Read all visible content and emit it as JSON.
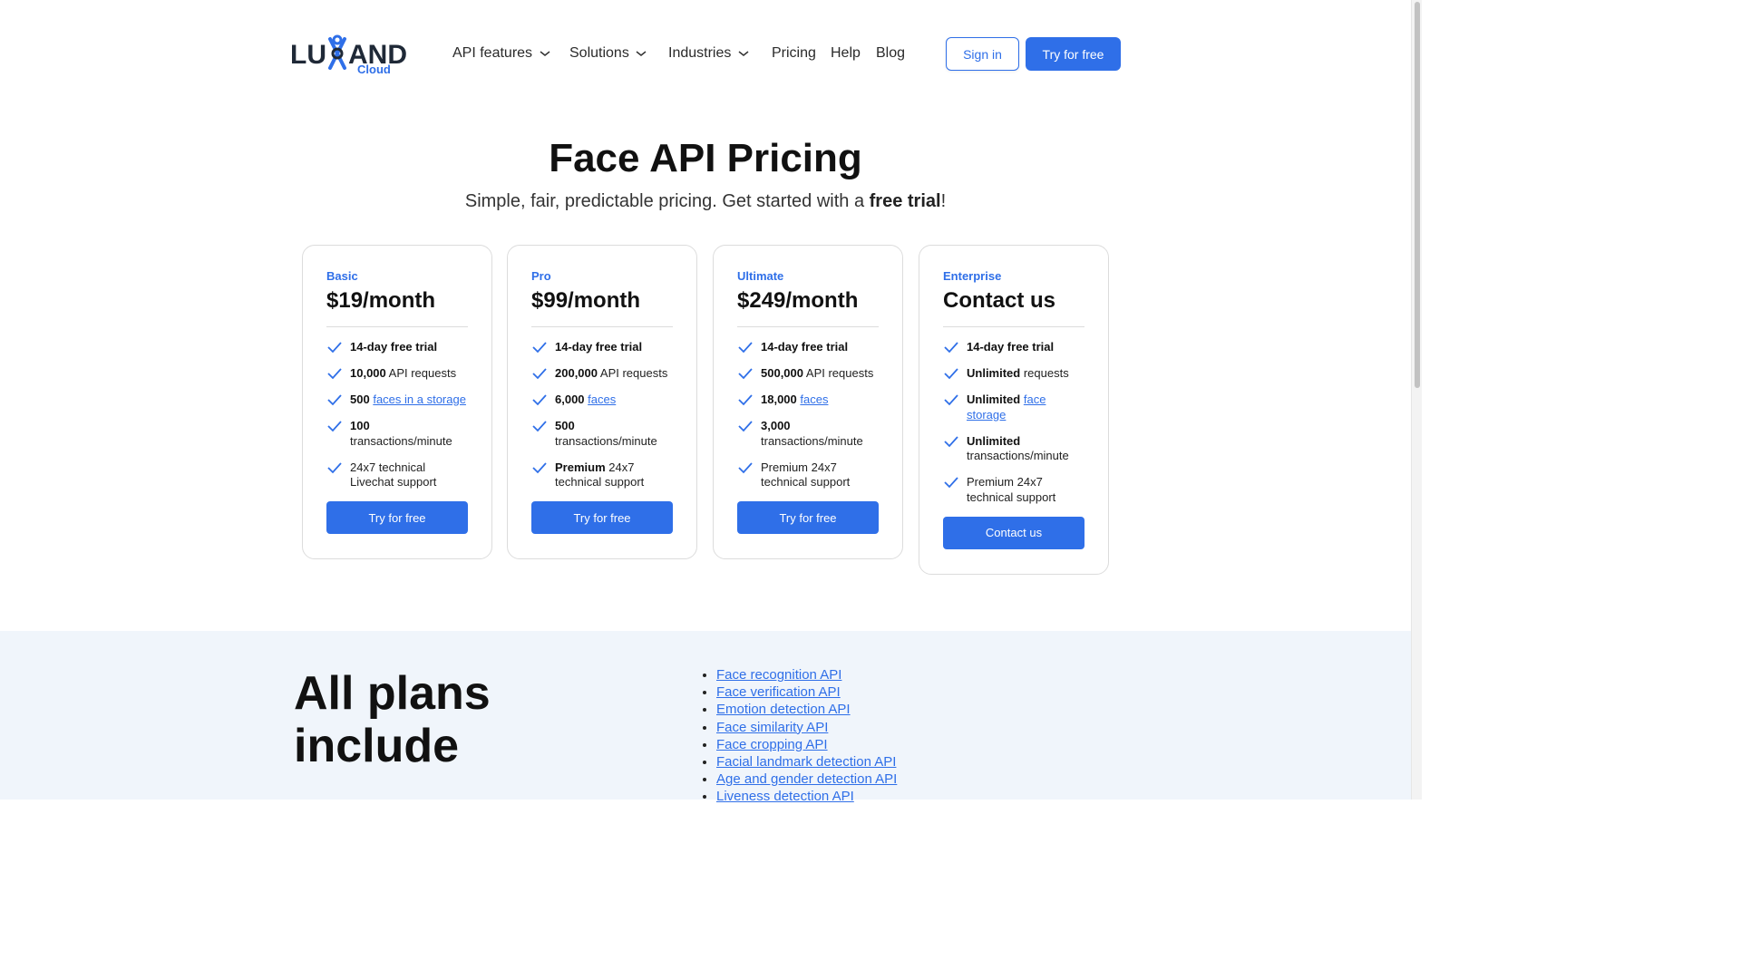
{
  "logo": {
    "text_main": "LUXAND",
    "text_sub": "Cloud"
  },
  "nav": {
    "items": [
      {
        "label": "API features",
        "dropdown": true
      },
      {
        "label": "Solutions",
        "dropdown": true
      },
      {
        "label": "Industries",
        "dropdown": true
      },
      {
        "label": "Pricing",
        "dropdown": false
      },
      {
        "label": "Help",
        "dropdown": false
      },
      {
        "label": "Blog",
        "dropdown": false
      }
    ],
    "sign_in": "Sign in",
    "try_free": "Try for free"
  },
  "hero": {
    "title": "Face API Pricing",
    "subtitle_pre": "Simple, fair, predictable pricing. Get started with a ",
    "subtitle_bold": "free trial",
    "subtitle_post": "!"
  },
  "plans": [
    {
      "name": "Basic",
      "price": "$19/month",
      "features": [
        {
          "bold": "14-day free trial",
          "text": "",
          "link": ""
        },
        {
          "bold": "10,000",
          "text": " API requests",
          "link": ""
        },
        {
          "bold": "500",
          "text": " ",
          "link": "faces in a storage"
        },
        {
          "bold": "100",
          "text": " transactions/minute",
          "link": ""
        },
        {
          "bold": "",
          "text": "24x7 technical Livechat support",
          "link": ""
        }
      ],
      "button": "Try for free"
    },
    {
      "name": "Pro",
      "price": "$99/month",
      "features": [
        {
          "bold": "14-day free trial",
          "text": "",
          "link": ""
        },
        {
          "bold": "200,000",
          "text": " API requests",
          "link": ""
        },
        {
          "bold": "6,000",
          "text": " ",
          "link": "faces"
        },
        {
          "bold": "500",
          "text": " transactions/minute",
          "link": ""
        },
        {
          "bold": "Premium",
          "text": " 24x7 technical support",
          "link": ""
        }
      ],
      "button": "Try for free"
    },
    {
      "name": "Ultimate",
      "price": "$249/month",
      "features": [
        {
          "bold": "14-day free trial",
          "text": "",
          "link": ""
        },
        {
          "bold": "500,000",
          "text": " API requests",
          "link": ""
        },
        {
          "bold": "18,000",
          "text": " ",
          "link": "faces"
        },
        {
          "bold": "3,000",
          "text": " transactions/minute",
          "link": ""
        },
        {
          "bold": "",
          "text": "Premium 24x7 technical support",
          "link": ""
        }
      ],
      "button": "Try for free"
    },
    {
      "name": "Enterprise",
      "price": "Contact us",
      "features": [
        {
          "bold": "14-day free trial",
          "text": "",
          "link": ""
        },
        {
          "bold": "Unlimited",
          "text": " requests",
          "link": ""
        },
        {
          "bold": "Unlimited",
          "text": " ",
          "link": "face storage"
        },
        {
          "bold": "Unlimited",
          "text": " transactions/minute",
          "link": ""
        },
        {
          "bold": "",
          "text": "Premium 24x7 technical support",
          "link": ""
        }
      ],
      "button": "Contact us"
    }
  ],
  "includes": {
    "title": "All plans include",
    "items": [
      "Face recognition API",
      "Face verification API",
      "Emotion detection API",
      "Face similarity API",
      "Face cropping API",
      "Facial landmark detection API",
      "Age and gender detection API",
      "Liveness detection API"
    ]
  },
  "colors": {
    "accent": "#2f6fe8",
    "logo_dark": "#1f2937",
    "section_bg": "#f0f5fb"
  }
}
